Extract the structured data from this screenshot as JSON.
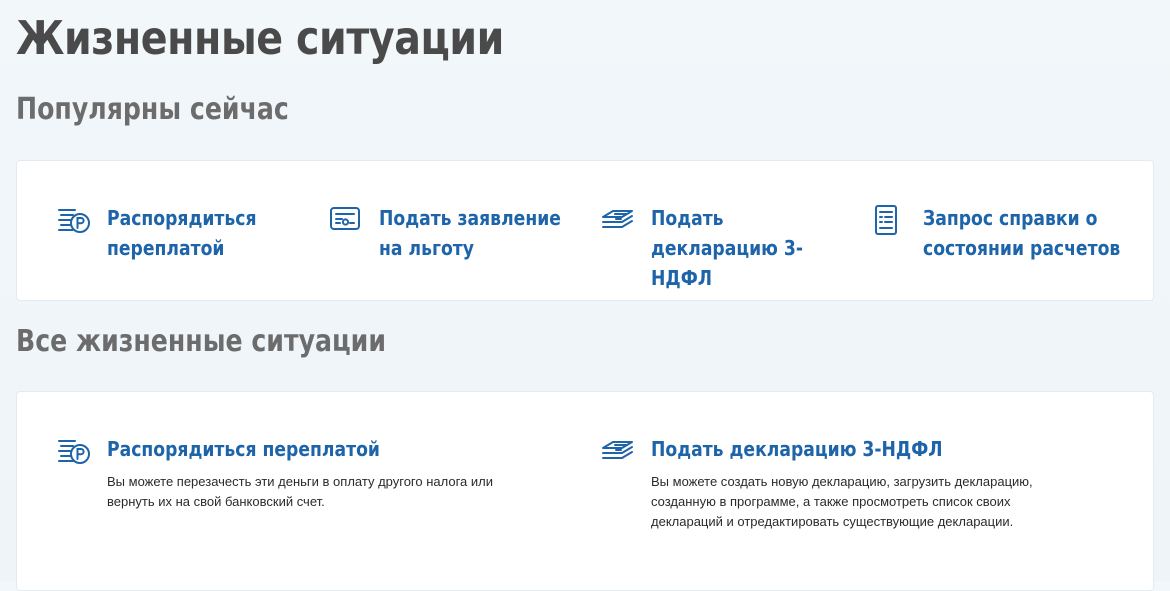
{
  "page": {
    "title": "Жизненные ситуации"
  },
  "popular": {
    "heading": "Популярны сейчас",
    "items": [
      {
        "label": "Распорядиться переплатой",
        "icon": "ruble-coins-icon"
      },
      {
        "label": "Подать заявление на льготу",
        "icon": "certificate-icon"
      },
      {
        "label": "Подать декларацию 3-НДФЛ",
        "icon": "documents-stack-icon"
      },
      {
        "label": "Запрос справки о состоянии расчетов",
        "icon": "document-list-icon"
      }
    ]
  },
  "all": {
    "heading": "Все жизненные ситуации",
    "items": [
      {
        "label": "Распорядиться переплатой",
        "icon": "ruble-coins-icon",
        "description": "Вы можете перезачесть эти деньги в оплату другого налога или вернуть их на свой банковский счет."
      },
      {
        "label": "Подать декларацию 3-НДФЛ",
        "icon": "documents-stack-icon",
        "description": "Вы можете создать новую декларацию, загрузить декларацию, созданную в программе, а также просмотреть список своих деклараций и отредактировать существующие декларации."
      }
    ]
  },
  "colors": {
    "accent": "#1d64a9",
    "heading": "#4a4a4a",
    "subheading": "#6c6c6c",
    "background": "#f2f7fa",
    "card": "#ffffff"
  }
}
